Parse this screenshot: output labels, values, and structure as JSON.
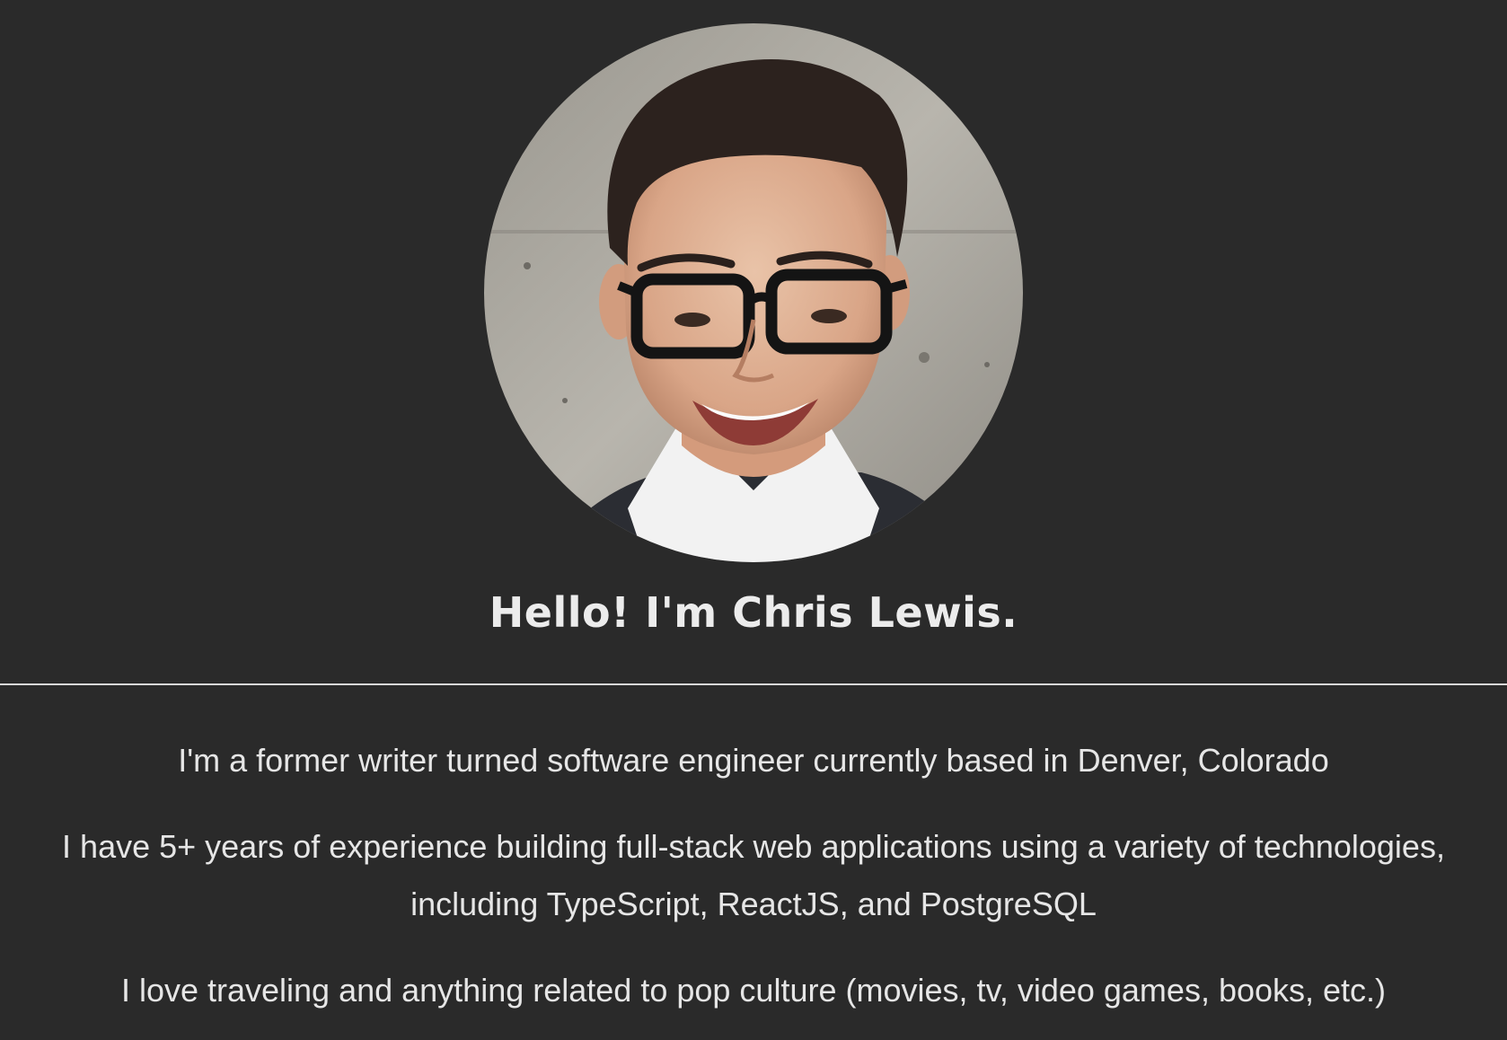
{
  "profile": {
    "greeting": "Hello! I'm Chris Lewis.",
    "bio": [
      "I'm a former writer turned software engineer currently based in Denver, Colorado",
      "I have 5+ years of experience building full-stack web applications using a variety of technologies, including TypeScript, ReactJS, and PostgreSQL",
      "I love traveling and anything related to pop culture (movies, tv, video games, books, etc.)"
    ]
  },
  "colors": {
    "background": "#2a2a2a",
    "text": "#ececec",
    "divider": "#d8d8d8"
  }
}
